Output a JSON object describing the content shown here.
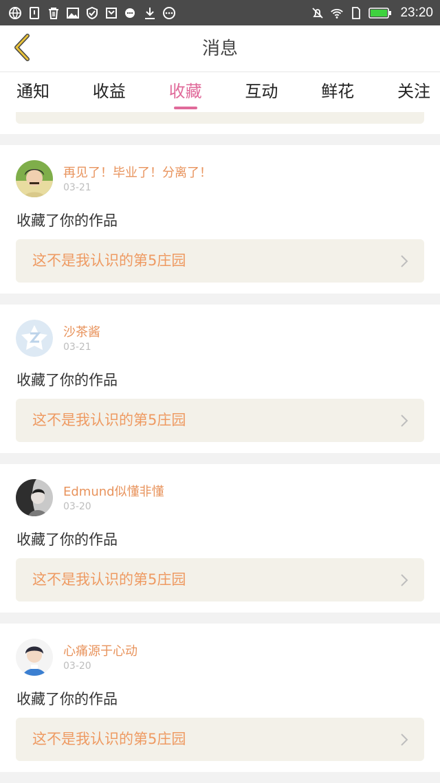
{
  "status_bar": {
    "time": "23:20",
    "left_icons": [
      "globe-icon",
      "sim-icon",
      "trash-icon",
      "image-icon",
      "shield-icon",
      "mail-icon",
      "chat-icon",
      "download-icon",
      "more-icon"
    ],
    "right_icons": [
      "mute-icon",
      "wifi-icon",
      "sim-card-icon",
      "battery-icon"
    ],
    "battery_color": "#3fd23f"
  },
  "header": {
    "title": "消息"
  },
  "tabs": [
    {
      "label": "通知",
      "active": false
    },
    {
      "label": "收益",
      "active": false
    },
    {
      "label": "收藏",
      "active": true
    },
    {
      "label": "互动",
      "active": false
    },
    {
      "label": "鲜花",
      "active": false
    },
    {
      "label": "关注",
      "active": false
    }
  ],
  "accent_color": "#e06a9a",
  "items": [
    {
      "username": "再见了！毕业了！分离了！",
      "date": "03-21",
      "action": "收藏了你的作品",
      "work_title": "这不是我认识的第5庄园",
      "avatar": "photo-green"
    },
    {
      "username": "沙茶酱",
      "date": "03-21",
      "action": "收藏了你的作品",
      "work_title": "这不是我认识的第5庄园",
      "avatar": "default-star"
    },
    {
      "username": "Edmund似懂非懂",
      "date": "03-20",
      "action": "收藏了你的作品",
      "work_title": "这不是我认识的第5庄园",
      "avatar": "photo-gray"
    },
    {
      "username": "心痛源于心动",
      "date": "03-20",
      "action": "收藏了你的作品",
      "work_title": "这不是我认识的第5庄园",
      "avatar": "photo-blue"
    }
  ]
}
